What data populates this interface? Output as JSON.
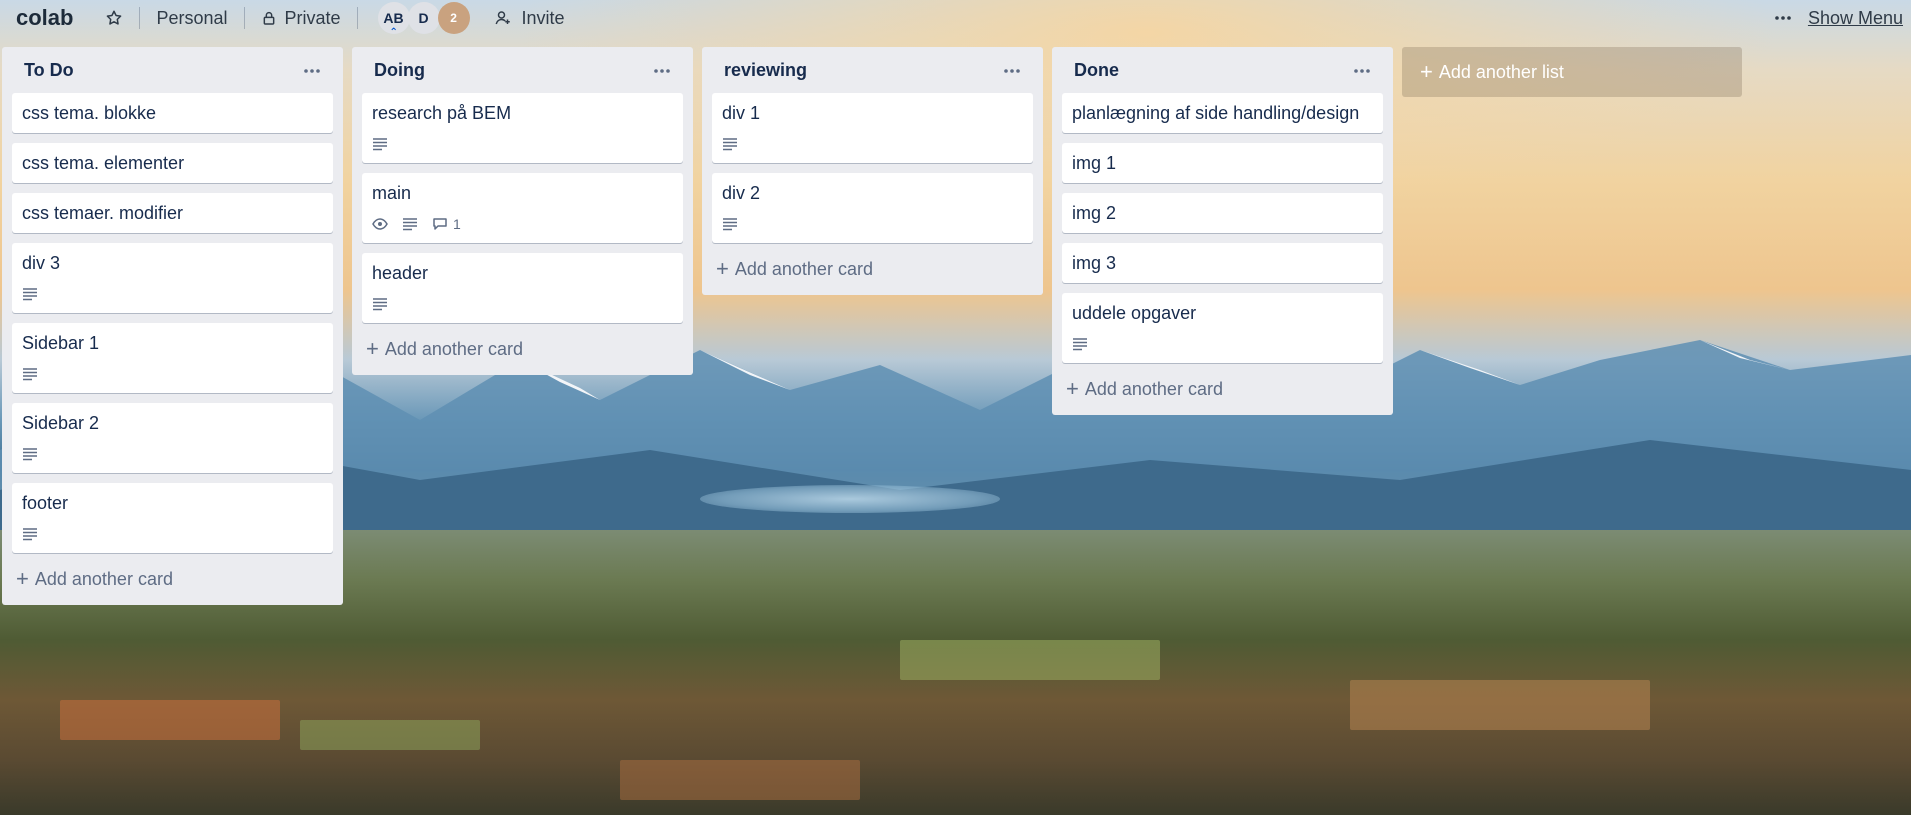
{
  "board": {
    "title": "colab",
    "visibility_team": "Personal",
    "visibility_privacy": "Private",
    "members": [
      {
        "initials": "AB"
      },
      {
        "initials": "D"
      }
    ],
    "more_members": "2",
    "invite_label": "Invite",
    "show_menu_label": "Show Menu"
  },
  "lists": [
    {
      "title": "To Do",
      "add_card_label": "Add another card",
      "cards": [
        {
          "title": "css tema. blokke"
        },
        {
          "title": "css tema. elementer"
        },
        {
          "title": "css temaer. modifier"
        },
        {
          "title": "div 3",
          "badges": [
            "description"
          ]
        },
        {
          "title": "Sidebar 1",
          "badges": [
            "description"
          ]
        },
        {
          "title": "Sidebar 2",
          "badges": [
            "description"
          ]
        },
        {
          "title": "footer",
          "badges": [
            "description"
          ]
        }
      ]
    },
    {
      "title": "Doing",
      "add_card_label": "Add another card",
      "cards": [
        {
          "title": "research på BEM",
          "badges": [
            "description"
          ]
        },
        {
          "title": "main",
          "badges": [
            "watch",
            "description",
            "comments"
          ],
          "comment_count": "1"
        },
        {
          "title": "header",
          "badges": [
            "description"
          ]
        }
      ]
    },
    {
      "title": "reviewing",
      "add_card_label": "Add another card",
      "cards": [
        {
          "title": "div 1",
          "badges": [
            "description"
          ]
        },
        {
          "title": "div 2",
          "badges": [
            "description"
          ]
        }
      ]
    },
    {
      "title": "Done",
      "add_card_label": "Add another card",
      "cards": [
        {
          "title": "planlægning af side handling/design"
        },
        {
          "title": "img 1"
        },
        {
          "title": "img 2"
        },
        {
          "title": "img 3"
        },
        {
          "title": "uddele opgaver",
          "badges": [
            "description"
          ]
        }
      ]
    }
  ],
  "add_list_label": "Add another list",
  "icons": {
    "star": "star-icon",
    "lock": "lock-icon",
    "invite": "invite-user-icon",
    "menu": "ellipsis-icon",
    "description": "description-lines-icon",
    "watch": "eye-icon",
    "comments": "comment-bubble-icon",
    "add": "plus-icon"
  },
  "colors": {
    "list_bg": "#ebecf0",
    "card_bg": "#ffffff",
    "text": "#172b4d",
    "muted": "#5e6c84"
  }
}
